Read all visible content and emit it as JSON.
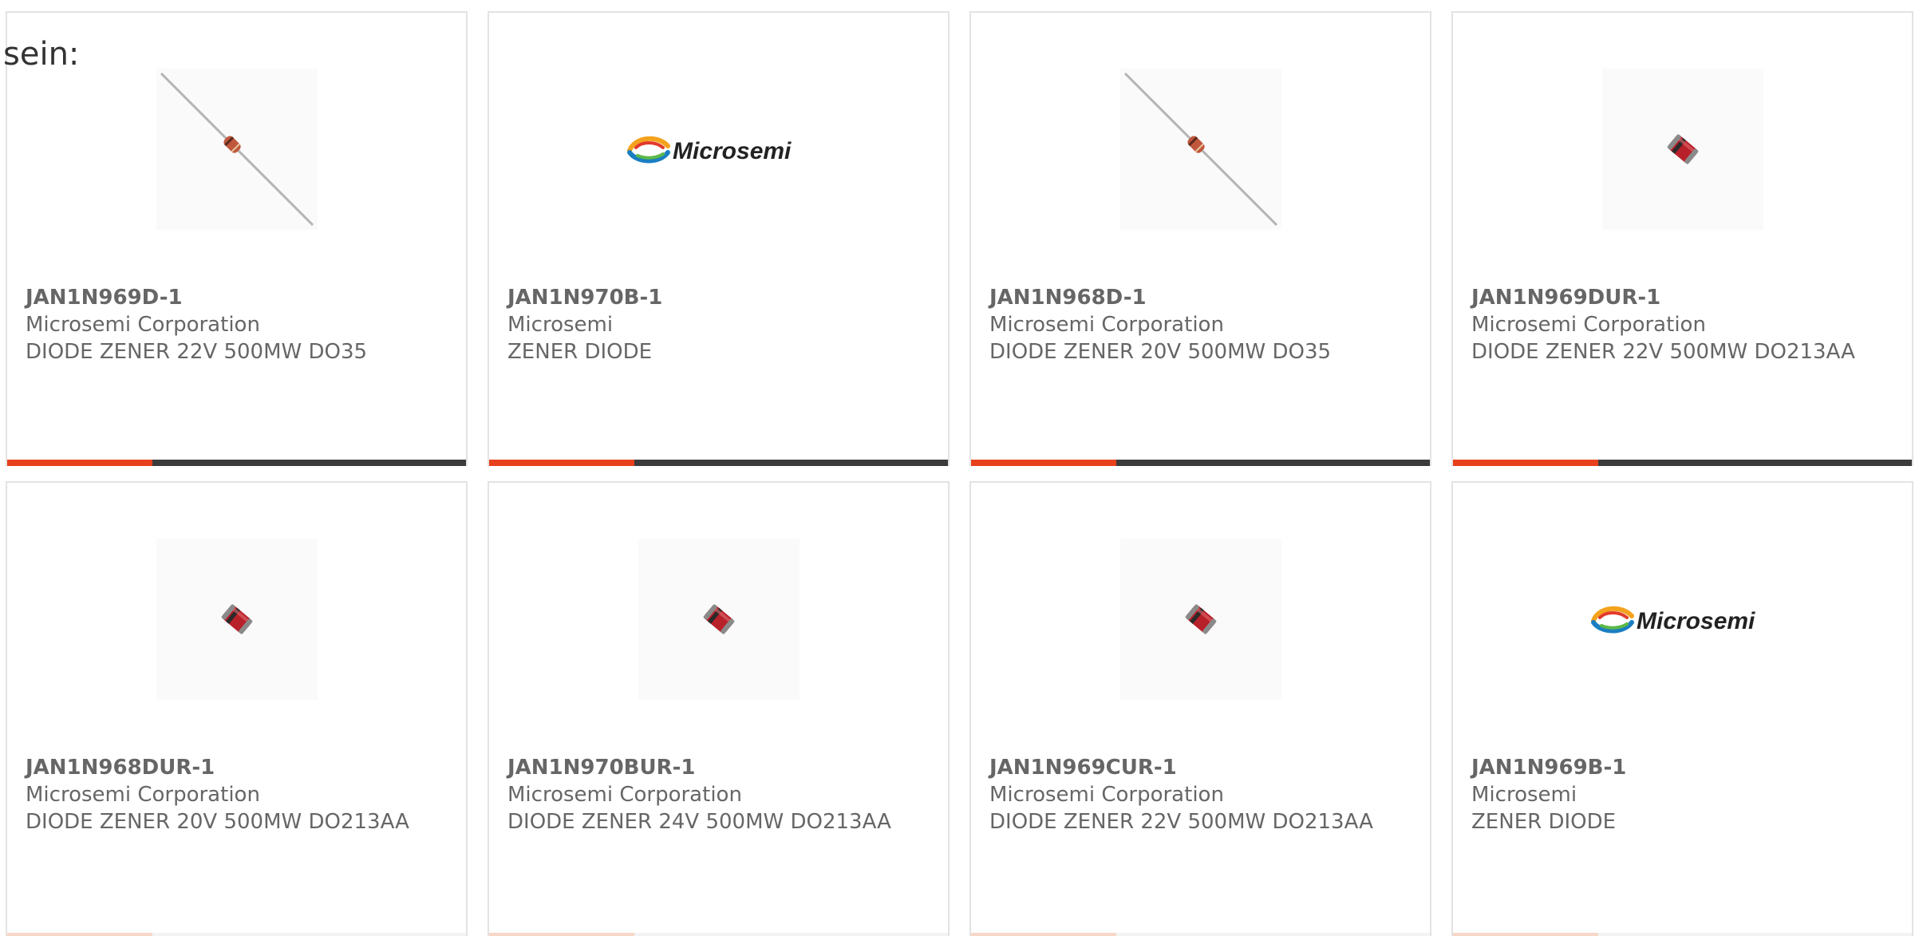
{
  "page_label": "sein:",
  "products": [
    {
      "part_number": "JAN1N969D-1",
      "manufacturer": "Microsemi Corporation",
      "description": "DIODE ZENER 22V 500MW DO35",
      "image": "axial-diode-icon"
    },
    {
      "part_number": "JAN1N970B-1",
      "manufacturer": "Microsemi",
      "description": "ZENER DIODE",
      "image": "microsemi-logo",
      "logo_text": "Microsemi"
    },
    {
      "part_number": "JAN1N968D-1",
      "manufacturer": "Microsemi Corporation",
      "description": "DIODE ZENER 20V 500MW DO35",
      "image": "axial-diode-icon"
    },
    {
      "part_number": "JAN1N969DUR-1",
      "manufacturer": "Microsemi Corporation",
      "description": "DIODE ZENER 22V 500MW DO213AA",
      "image": "melf-diode-icon"
    },
    {
      "part_number": "JAN1N968DUR-1",
      "manufacturer": "Microsemi Corporation",
      "description": "DIODE ZENER 20V 500MW DO213AA",
      "image": "melf-diode-icon"
    },
    {
      "part_number": "JAN1N970BUR-1",
      "manufacturer": "Microsemi Corporation",
      "description": "DIODE ZENER 24V 500MW DO213AA",
      "image": "melf-diode-icon"
    },
    {
      "part_number": "JAN1N969CUR-1",
      "manufacturer": "Microsemi Corporation",
      "description": "DIODE ZENER 22V 500MW DO213AA",
      "image": "melf-diode-icon"
    },
    {
      "part_number": "JAN1N969B-1",
      "manufacturer": "Microsemi",
      "description": "ZENER DIODE",
      "image": "microsemi-logo",
      "logo_text": "Microsemi"
    }
  ],
  "colors": {
    "accent": "#e8401c",
    "bar_dark": "#3b3b3b",
    "text": "#666666",
    "card_border": "#e3e3e3"
  }
}
